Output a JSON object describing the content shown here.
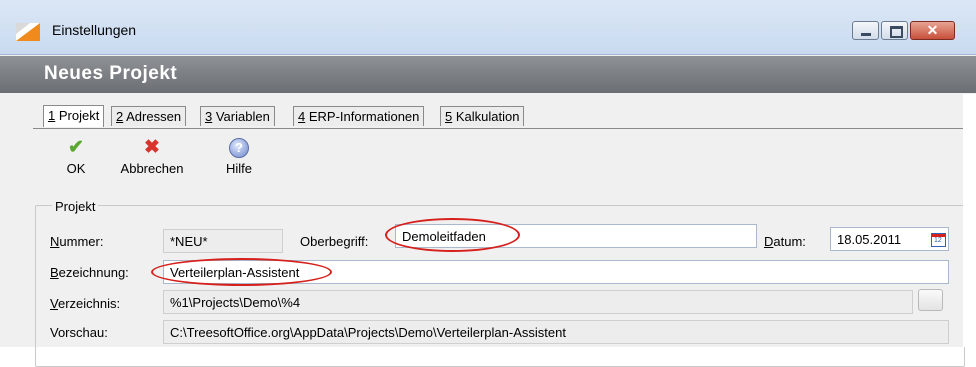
{
  "window": {
    "title": "Einstellungen",
    "minimize_icon": "minimize-icon",
    "maximize_icon": "maximize-icon",
    "close_glyph": "✕"
  },
  "header": {
    "title": "Neues Projekt"
  },
  "tabs": [
    {
      "accel": "1",
      "label": " Projekt",
      "active": true
    },
    {
      "accel": "2",
      "label": " Adressen",
      "active": false
    },
    {
      "accel": "3",
      "label": " Variablen",
      "active": false
    },
    {
      "accel": "4",
      "label": " ERP-Informationen",
      "active": false
    },
    {
      "accel": "5",
      "label": " Kalkulation",
      "active": false
    }
  ],
  "toolbar": {
    "ok_label": "OK",
    "ok_icon": "✔",
    "cancel_label": "Abbrechen",
    "cancel_icon": "✖",
    "help_label": "Hilfe",
    "help_icon": "?"
  },
  "projekt": {
    "group_label": "Projekt",
    "nummer_accel": "N",
    "nummer_label_rest": "ummer:",
    "nummer_value": "*NEU*",
    "oberbegriff_label": "Oberbegriff:",
    "oberbegriff_value": "Demoleitfaden",
    "datum_accel": "D",
    "datum_label_rest": "atum:",
    "datum_value": "18.05.2011",
    "calendar_number": "12",
    "bezeichnung_accel": "B",
    "bezeichnung_label_rest": "ezeichnung:",
    "bezeichnung_value": "Verteilerplan-Assistent",
    "verzeichnis_accel": "V",
    "verzeichnis_label_rest": "erzeichnis:",
    "verzeichnis_value": "%1\\Projects\\Demo\\%4",
    "vorschau_label": "Vorschau:",
    "vorschau_value": "C:\\TreesoftOffice.org\\AppData\\Projects\\Demo\\Verteilerplan-Assistent"
  },
  "colors": {
    "header_band": "#7c8085",
    "highlight_ellipse": "#d6201c",
    "ok_green": "#5aa830",
    "cancel_red": "#d9342b"
  }
}
